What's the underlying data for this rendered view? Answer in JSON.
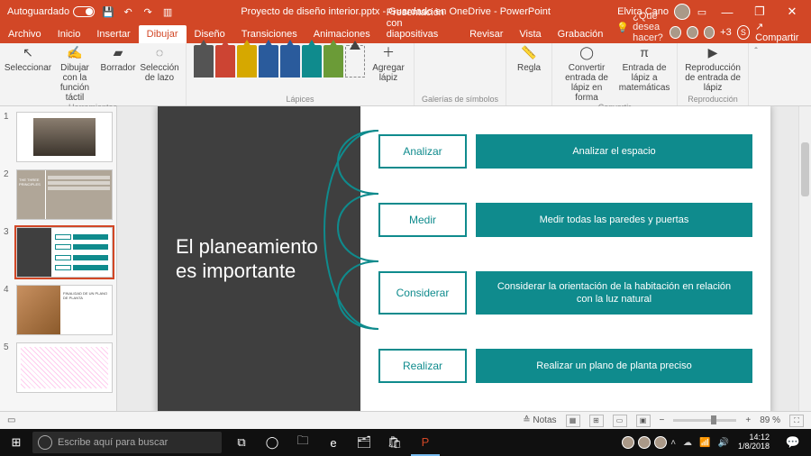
{
  "titlebar": {
    "autosave_label": "Autoguardado",
    "doc_title": "Proyecto de diseño interior.pptx - Guardado en OneDrive - PowerPoint",
    "user_name": "Elvira Cano"
  },
  "tabs": {
    "archivo": "Archivo",
    "inicio": "Inicio",
    "insertar": "Insertar",
    "dibujar": "Dibujar",
    "diseno": "Diseño",
    "transiciones": "Transiciones",
    "animaciones": "Animaciones",
    "presentacion": "Presentación con diapositivas",
    "revisar": "Revisar",
    "vista": "Vista",
    "grabacion": "Grabación",
    "tellme": "¿Qué desea hacer?",
    "share": "Compartir",
    "plus_count": "+3"
  },
  "ribbon": {
    "herramientas": {
      "seleccionar": "Seleccionar",
      "dibujar_tactil": "Dibujar con la función táctil",
      "borrador": "Borrador",
      "lazo": "Selección de lazo",
      "label": "Herramientas"
    },
    "lapices": {
      "agregar": "Agregar lápiz",
      "label": "Lápices"
    },
    "galerias": {
      "label": "Galerías de símbolos"
    },
    "regla": {
      "btn": "Regla"
    },
    "convertir": {
      "entrada_forma": "Convertir entrada de lápiz en forma",
      "entrada_mat": "Entrada de lápiz a matemáticas",
      "label": "Convertir"
    },
    "reproduccion": {
      "btn": "Reproducción de entrada de lápiz",
      "label": "Reproducción"
    }
  },
  "slide": {
    "title": "El planeamiento es importante",
    "rows": [
      {
        "key": "Analizar",
        "desc": "Analizar el espacio"
      },
      {
        "key": "Medir",
        "desc": "Medir todas las paredes y puertas"
      },
      {
        "key": "Considerar",
        "desc": "Considerar la orientación de la habitación en relación con la luz natural"
      },
      {
        "key": "Realizar",
        "desc": "Realizar un plano de planta preciso"
      }
    ]
  },
  "thumbs": {
    "t2_title": "THE THREE PRINCIPLES",
    "t4_title": "FINALIDAD DE UN PLANO DE PLANTA"
  },
  "statusbar": {
    "notas": "Notas",
    "zoom": "89 %"
  },
  "taskbar": {
    "search_placeholder": "Escribe aquí para buscar",
    "time": "14:12",
    "date": "1/8/2018"
  }
}
